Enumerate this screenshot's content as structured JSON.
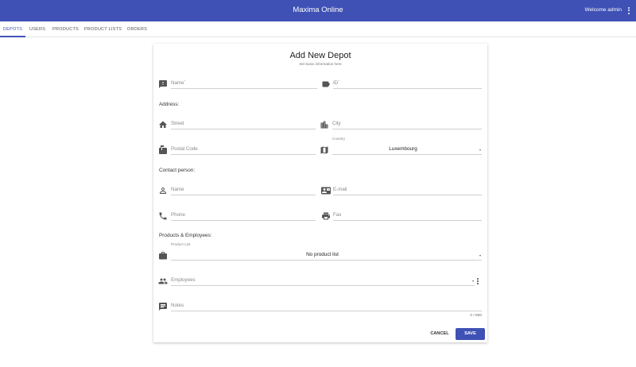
{
  "app": {
    "title": "Maxima Online",
    "welcome": "Welcome admin"
  },
  "tabs": [
    {
      "label": "DEPOTS",
      "active": true
    },
    {
      "label": "USERS",
      "active": false
    },
    {
      "label": "PRODUCTS",
      "active": false
    },
    {
      "label": "PRODUCT LISTS",
      "active": false
    },
    {
      "label": "ORDERS",
      "active": false
    }
  ],
  "form": {
    "title": "Add New Depot",
    "subtitle": "Set basic information here",
    "name_placeholder": "Name",
    "id_placeholder": "ID",
    "required_mark": "*",
    "address_heading": "Address:",
    "street_placeholder": "Street",
    "city_placeholder": "City",
    "postal_code_placeholder": "Postal Code",
    "country_label": "Country",
    "country_value": "Luxembourg",
    "contact_heading": "Contact person:",
    "contact_name_placeholder": "Name",
    "email_placeholder": "E-mail",
    "phone_placeholder": "Phone",
    "fax_placeholder": "Fax",
    "products_heading": "Products & Employees:",
    "product_list_label": "Product List",
    "product_list_value": "No product list",
    "employees_placeholder": "Employees",
    "notes_placeholder": "Notes",
    "notes_counter": "0 / 500",
    "cancel_label": "CANCEL",
    "save_label": "SAVE"
  },
  "colors": {
    "primary": "#3f51b5",
    "icon": "#555555"
  }
}
